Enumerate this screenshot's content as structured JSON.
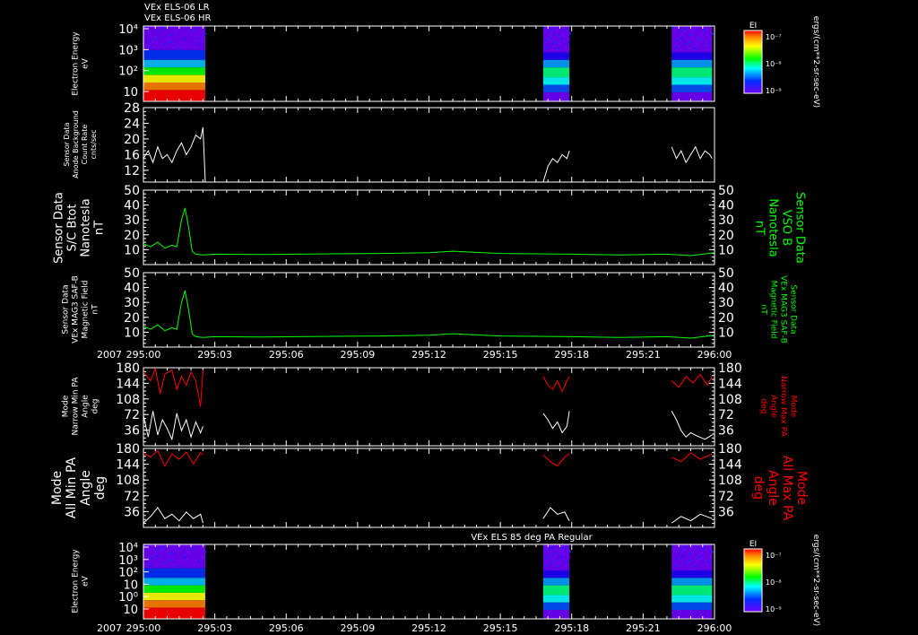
{
  "header": {
    "line1": "VEx ELS-06 LR",
    "line2": "VEx ELS-06 HR"
  },
  "year": "2007",
  "time_ticks": [
    "295:00",
    "295:03",
    "295:06",
    "295:09",
    "295:12",
    "295:15",
    "295:18",
    "295:21",
    "296:00"
  ],
  "chart_data": [
    {
      "type": "heatmap",
      "name": "spectrogram-top",
      "ylabel": [
        "Electron Energy",
        "eV"
      ],
      "ytick_labels": [
        "10",
        "10²",
        "10³",
        "10⁴"
      ],
      "colorbar": {
        "title": "EI",
        "tick_labels": [
          "10⁻⁷",
          "10⁻⁸",
          "10⁻⁹"
        ]
      },
      "units_label": "ergs/(cm**2-sr-sec-eV)",
      "data_blocks": [
        {
          "t_start": 0,
          "t_end": 2.6,
          "level": "high"
        },
        {
          "t_start": 16.8,
          "t_end": 17.9,
          "level": "medium"
        },
        {
          "t_start": 22.2,
          "t_end": 23.9,
          "level": "medium"
        }
      ]
    },
    {
      "type": "line",
      "name": "anode-background",
      "ylabel": [
        "Sensor Data",
        "Anode Background",
        "Count Rate",
        "cnts/sec"
      ],
      "yticks": [
        12,
        16,
        20,
        24,
        28
      ],
      "ylim": [
        9,
        28
      ],
      "series": [
        {
          "color": "#ffffff",
          "segments": [
            {
              "x": [
                0,
                0.2,
                0.4,
                0.6,
                0.8,
                1.0,
                1.2,
                1.4,
                1.6,
                1.8,
                2.0,
                2.2,
                2.4,
                2.5,
                2.6
              ],
              "y": [
                15,
                17,
                14,
                18,
                15,
                16,
                14,
                17,
                19,
                16,
                18,
                21,
                20,
                23,
                9
              ]
            },
            {
              "x": [
                16.8,
                17.0,
                17.2,
                17.4,
                17.6,
                17.8,
                17.9
              ],
              "y": [
                9,
                13,
                15,
                14,
                16,
                15,
                17
              ]
            },
            {
              "x": [
                22.2,
                22.4,
                22.6,
                22.8,
                23.0,
                23.2,
                23.4,
                23.6,
                23.8,
                23.9
              ],
              "y": [
                18,
                15,
                17,
                14,
                16,
                18,
                15,
                17,
                16,
                15
              ]
            }
          ]
        }
      ]
    },
    {
      "type": "line",
      "name": "bmag-vso",
      "ylabel": [
        "Sensor Data",
        "S/C Btot",
        "Nanotesla",
        "nT"
      ],
      "ylabel_right": [
        "Sensor Data",
        "VSO B",
        "Nanotesla",
        "nT"
      ],
      "yticks": [
        10,
        20,
        30,
        40,
        50
      ],
      "ylim": [
        0,
        50
      ],
      "series": [
        {
          "color": "#00ff00",
          "segments": [
            {
              "x": [
                0,
                0.3,
                0.6,
                0.9,
                1.2,
                1.4,
                1.6,
                1.75,
                1.9,
                2.05,
                2.2,
                2.5,
                3,
                5,
                8,
                10,
                12,
                13,
                15,
                18,
                20,
                22,
                23,
                24
              ],
              "y": [
                14,
                12,
                15,
                11,
                13,
                12,
                30,
                38,
                25,
                9,
                7,
                6.5,
                7,
                6.8,
                7.2,
                7.5,
                8,
                9,
                7.5,
                7,
                6.5,
                7,
                6,
                8
              ]
            }
          ]
        }
      ]
    },
    {
      "type": "line",
      "name": "mag-saf",
      "ylabel": [
        "Sensor Data",
        "VEx MAG3 SAF-B",
        "Magnetic Field",
        "nT"
      ],
      "ylabel_right": [
        "Sensor Data",
        "VEx MAG3 SAF-B",
        "Magnetic Field",
        "nT"
      ],
      "yticks": [
        10,
        20,
        30,
        40,
        50
      ],
      "ylim": [
        0,
        50
      ],
      "series": [
        {
          "color": "#00ff00",
          "segments": [
            {
              "x": [
                0,
                0.3,
                0.6,
                0.9,
                1.2,
                1.4,
                1.6,
                1.75,
                1.9,
                2.05,
                2.2,
                2.5,
                3,
                5,
                8,
                10,
                12,
                13,
                15,
                18,
                20,
                22,
                23,
                24
              ],
              "y": [
                14,
                12,
                15,
                11,
                13,
                12,
                30,
                38,
                25,
                9,
                7,
                6.5,
                7,
                6.8,
                7.2,
                7.5,
                8,
                9,
                7.5,
                7,
                6.5,
                7,
                6,
                8
              ]
            }
          ]
        }
      ]
    },
    {
      "type": "line",
      "name": "pa-narrow",
      "ylabel": [
        "Mode",
        "Narrow Min PA",
        "Angle",
        "deg"
      ],
      "ylabel_right": [
        "Mode",
        "Narrow Max PA",
        "Angle",
        "deg"
      ],
      "yticks": [
        36,
        72,
        108,
        144,
        180
      ],
      "ylim": [
        0,
        180
      ],
      "series": [
        {
          "name": "max",
          "color": "#ff0000",
          "segments": [
            {
              "x": [
                0,
                0.3,
                0.5,
                0.7,
                0.9,
                1.2,
                1.4,
                1.6,
                1.8,
                2.0,
                2.2,
                2.4,
                2.5
              ],
              "y": [
                170,
                150,
                178,
                120,
                165,
                175,
                130,
                160,
                140,
                170,
                150,
                90,
                175
              ]
            },
            {
              "x": [
                16.8,
                17.0,
                17.2,
                17.4,
                17.6,
                17.8,
                17.9
              ],
              "y": [
                160,
                140,
                130,
                150,
                125,
                150,
                160
              ]
            },
            {
              "x": [
                22.2,
                22.5,
                22.8,
                23.1,
                23.4,
                23.7,
                23.9
              ],
              "y": [
                150,
                135,
                160,
                145,
                165,
                140,
                160
              ]
            }
          ]
        },
        {
          "name": "min",
          "color": "#ffffff",
          "segments": [
            {
              "x": [
                0,
                0.2,
                0.4,
                0.6,
                0.8,
                1.0,
                1.2,
                1.4,
                1.6,
                1.8,
                2.0,
                2.2,
                2.4,
                2.5
              ],
              "y": [
                70,
                20,
                80,
                25,
                60,
                40,
                15,
                75,
                35,
                60,
                20,
                55,
                30,
                45
              ]
            },
            {
              "x": [
                16.8,
                17.0,
                17.2,
                17.4,
                17.6,
                17.8,
                17.9
              ],
              "y": [
                75,
                60,
                40,
                55,
                30,
                45,
                80
              ]
            },
            {
              "x": [
                22.2,
                22.4,
                22.6,
                22.8,
                23.0,
                23.3,
                23.6,
                23.9
              ],
              "y": [
                80,
                60,
                35,
                20,
                30,
                22,
                15,
                25
              ]
            }
          ]
        }
      ]
    },
    {
      "type": "line",
      "name": "pa-all",
      "ylabel": [
        "Mode",
        "All Min PA",
        "Angle",
        "deg"
      ],
      "ylabel_right": [
        "Mode",
        "All Max PA",
        "Angle",
        "deg"
      ],
      "yticks": [
        36,
        72,
        108,
        144,
        180
      ],
      "ylim": [
        0,
        180
      ],
      "series": [
        {
          "name": "max",
          "color": "#ff0000",
          "segments": [
            {
              "x": [
                0,
                0.3,
                0.6,
                0.9,
                1.2,
                1.5,
                1.8,
                2.1,
                2.4,
                2.5
              ],
              "y": [
                170,
                160,
                175,
                140,
                168,
                155,
                172,
                145,
                170,
                165
              ]
            },
            {
              "x": [
                16.8,
                17.1,
                17.4,
                17.7,
                17.9
              ],
              "y": [
                165,
                150,
                140,
                160,
                168
              ]
            },
            {
              "x": [
                22.2,
                22.6,
                23.0,
                23.4,
                23.9
              ],
              "y": [
                160,
                150,
                170,
                155,
                168
              ]
            }
          ]
        },
        {
          "name": "min",
          "color": "#ffffff",
          "segments": [
            {
              "x": [
                0,
                0.3,
                0.6,
                0.9,
                1.2,
                1.5,
                1.8,
                2.1,
                2.4,
                2.5
              ],
              "y": [
                10,
                25,
                45,
                20,
                30,
                15,
                35,
                20,
                30,
                10
              ]
            },
            {
              "x": [
                16.8,
                17.1,
                17.4,
                17.7,
                17.9
              ],
              "y": [
                20,
                45,
                30,
                35,
                15
              ]
            },
            {
              "x": [
                22.2,
                22.6,
                23.0,
                23.4,
                23.9
              ],
              "y": [
                10,
                25,
                15,
                30,
                20
              ]
            }
          ]
        }
      ]
    },
    {
      "type": "heatmap",
      "name": "spectrogram-bottom",
      "title": "VEx ELS 85 deg PA Regular",
      "ylabel": [
        "Electron Energy",
        "eV"
      ],
      "ytick_labels": [
        "10",
        "10⁰",
        "10",
        "10²",
        "10³",
        "10⁴"
      ],
      "colorbar": {
        "title": "EI",
        "tick_labels": [
          "10⁻⁷",
          "10⁻⁸",
          "10⁻⁹"
        ]
      },
      "units_label": "ergs/(cm**2-sr-sec-eV)",
      "data_blocks": [
        {
          "t_start": 0,
          "t_end": 2.6,
          "level": "high"
        },
        {
          "t_start": 16.8,
          "t_end": 17.9,
          "level": "medium"
        },
        {
          "t_start": 22.2,
          "t_end": 23.9,
          "level": "medium"
        }
      ]
    }
  ]
}
